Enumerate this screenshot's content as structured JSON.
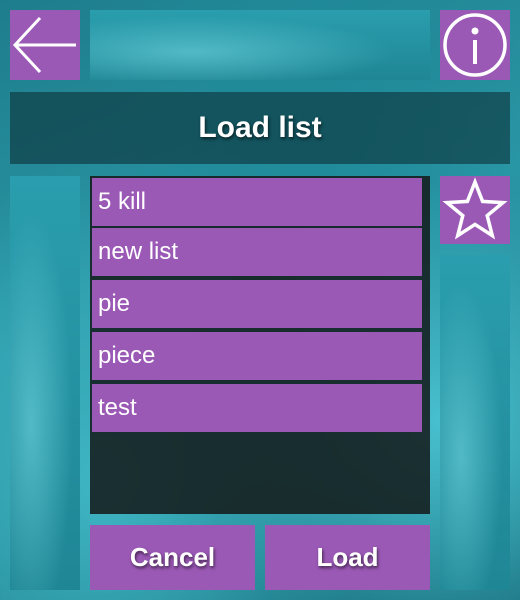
{
  "header": {
    "title": "Load list"
  },
  "icons": {
    "back": "arrow-left-icon",
    "info": "info-icon",
    "favorite": "star-icon"
  },
  "list": {
    "items": [
      {
        "label": "5 kill"
      },
      {
        "label": "new list"
      },
      {
        "label": "pie"
      },
      {
        "label": "piece"
      },
      {
        "label": "test"
      }
    ]
  },
  "actions": {
    "cancel_label": "Cancel",
    "load_label": "Load"
  },
  "colors": {
    "accent": "#9b59b6",
    "panel": "#141c1c"
  }
}
